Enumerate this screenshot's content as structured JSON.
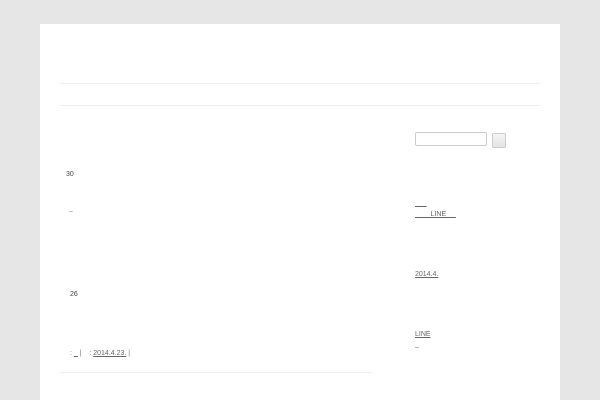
{
  "post": {
    "day_1": "30",
    "dash": "–",
    "day_2": "26",
    "meta_prefix": ": ",
    "meta_cat": "_",
    "meta_sep": " |    : ",
    "meta_date": "2014.4.23.",
    "meta_end": " |"
  },
  "sidebar": {
    "search_placeholder": "",
    "link_1": "      ",
    "link_2": "        LINE     ",
    "archive": "2014.4.",
    "category_1": "LINE",
    "category_2": "–"
  }
}
